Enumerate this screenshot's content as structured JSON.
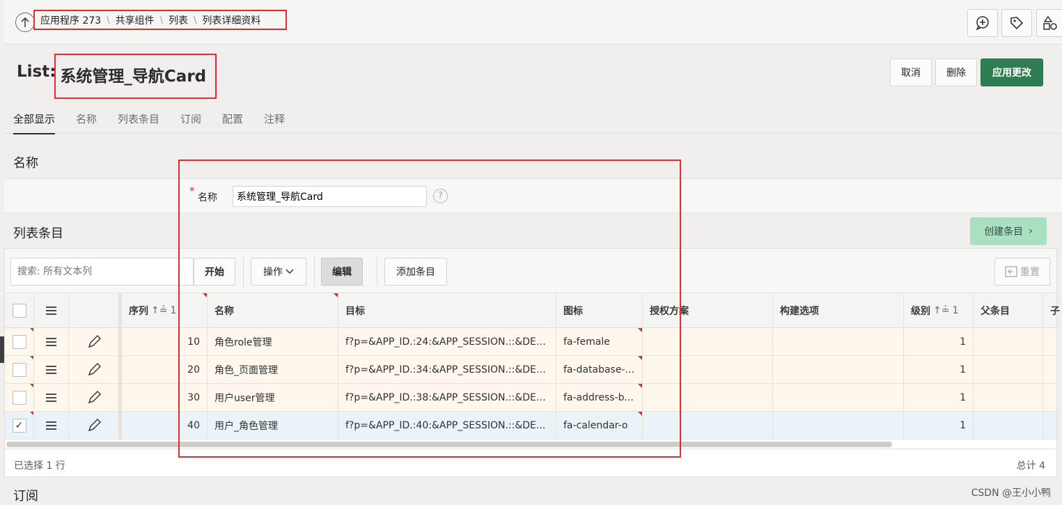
{
  "breadcrumb": {
    "items": [
      "应用程序 273",
      "共享组件",
      "列表",
      "列表详细资料"
    ]
  },
  "header": {
    "title_prefix": "List:",
    "title_name": "系统管理_导航Card",
    "buttons": {
      "cancel": "取消",
      "delete": "删除",
      "apply": "应用更改"
    }
  },
  "tabs": [
    "全部显示",
    "名称",
    "列表条目",
    "订阅",
    "配置",
    "注释"
  ],
  "sections": {
    "name": {
      "heading": "名称",
      "field_label": "名称",
      "field_value": "系统管理_导航Card",
      "help_icon": "?"
    },
    "list_entries": {
      "heading": "列表条目",
      "create_button": "创建条目"
    },
    "subscription": {
      "heading": "订阅"
    }
  },
  "grid": {
    "toolbar": {
      "search_placeholder": "搜索: 所有文本列",
      "go": "开始",
      "actions": "操作",
      "edit": "编辑",
      "add_row": "添加条目",
      "reset": "重置"
    },
    "columns": [
      "序列",
      "名称",
      "目标",
      "图标",
      "授权方案",
      "构建选项",
      "级别",
      "父条目",
      "子"
    ],
    "sort_indicators": {
      "seq": "1",
      "level": "1"
    },
    "rows": [
      {
        "seq": "10",
        "name": "角色role管理",
        "target": "f?p=&APP_ID.:24:&APP_SESSION.::&DEB...",
        "icon": "fa-female",
        "level": "1",
        "selected": false
      },
      {
        "seq": "20",
        "name": "角色_页面管理",
        "target": "f?p=&APP_ID.:34:&APP_SESSION.::&DEB...",
        "icon": "fa-database-...",
        "level": "1",
        "selected": false
      },
      {
        "seq": "30",
        "name": "用户user管理",
        "target": "f?p=&APP_ID.:38:&APP_SESSION.::&DEB...",
        "icon": "fa-address-b...",
        "level": "1",
        "selected": false
      },
      {
        "seq": "40",
        "name": "用户_角色管理",
        "target": "f?p=&APP_ID.:40:&APP_SESSION.::&DE...",
        "icon": "fa-calendar-o",
        "level": "1",
        "selected": true
      }
    ],
    "footer": {
      "selected": "已选择 1 行",
      "total": "总计 4"
    }
  },
  "watermark": "CSDN @王小小鸭",
  "colors": {
    "primary": "#2f7d52",
    "create": "#abdfc2",
    "row_bg": "#fdf7ed",
    "row_selected": "#eaf4f8",
    "annotation": "#e32b2b"
  }
}
